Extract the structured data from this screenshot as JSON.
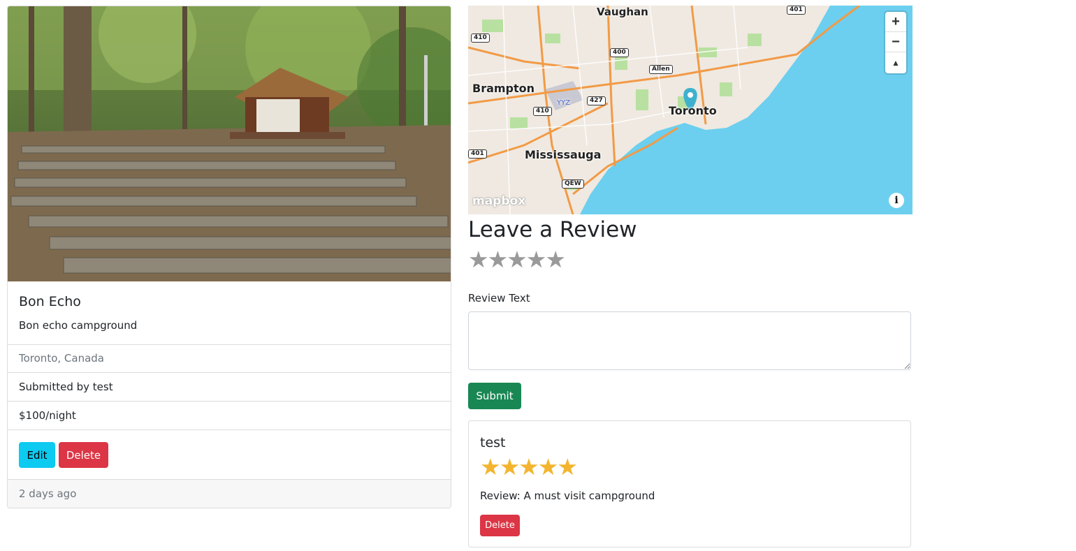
{
  "campground": {
    "title": "Bon Echo",
    "description": "Bon echo campground",
    "location": "Toronto, Canada",
    "submitted_by": "Submitted by test",
    "price": "$100/night",
    "edit_label": "Edit",
    "delete_label": "Delete",
    "posted": "2 days ago"
  },
  "map": {
    "cities": {
      "vaughan": "Vaughan",
      "brampton": "Brampton",
      "toronto": "Toronto",
      "mississauga": "Mississauga"
    },
    "airport": "YYZ",
    "roads": {
      "r401_top": "401",
      "r410_top": "410",
      "r400": "400",
      "allen": "Allen",
      "r410_mid": "410",
      "r427": "427",
      "r401_left": "401",
      "qew": "QEW"
    },
    "zoom_in": "+",
    "zoom_out": "−",
    "compass": "▲",
    "attribution_logo": "mapbox",
    "info": "i",
    "colors": {
      "water": "#6ccfef",
      "land": "#efe9e1",
      "highway": "#f29a46",
      "park": "#b8e0a0",
      "pin": "#3fb1ce"
    }
  },
  "review_form": {
    "heading": "Leave a Review",
    "rating_stars": "★★★★★",
    "rating_value": 0,
    "text_label": "Review Text",
    "text_value": "",
    "submit_label": "Submit"
  },
  "reviews": [
    {
      "author": "test",
      "stars": "★★★★★",
      "rating": 5,
      "body": "Review: A must visit campground",
      "delete_label": "Delete"
    }
  ],
  "colors": {
    "edit": "#0dcaf0",
    "danger": "#dc3545",
    "success": "#198754",
    "star_filled": "#f3b52f",
    "star_empty": "#9a9a9a"
  }
}
